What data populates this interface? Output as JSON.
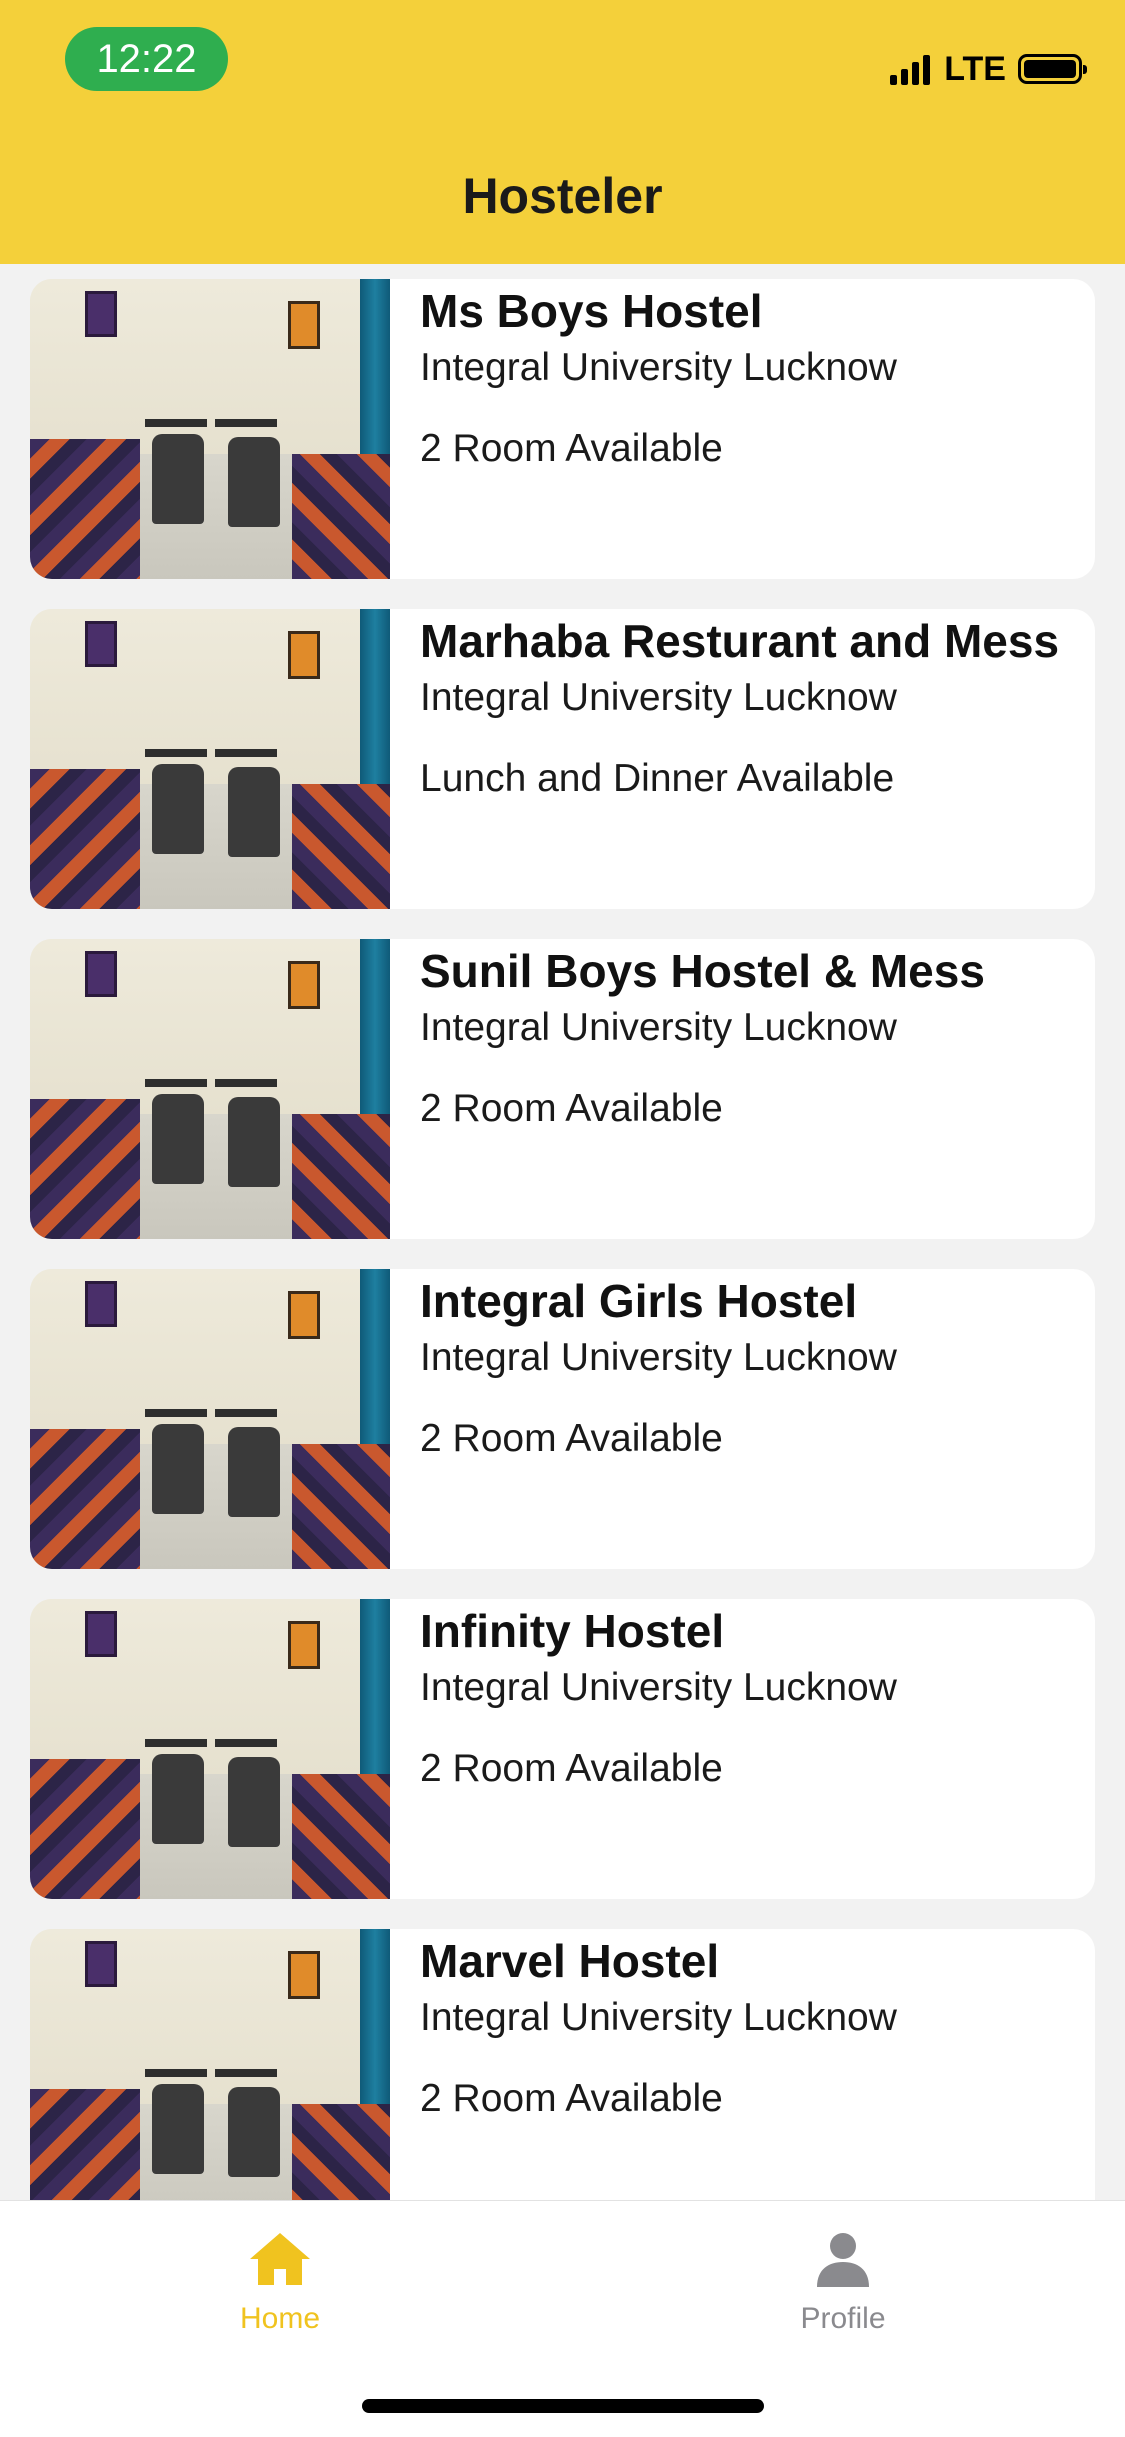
{
  "status_bar": {
    "time": "12:22",
    "network": "LTE",
    "time_pill_color": "#2fae4f"
  },
  "header": {
    "title": "Hosteler",
    "background_color": "#f4d03a"
  },
  "listings": [
    {
      "name": "Ms Boys Hostel",
      "location": "Integral University Lucknow",
      "availability": "2 Room Available"
    },
    {
      "name": "Marhaba Resturant and Mess",
      "location": "Integral University Lucknow",
      "availability": "Lunch and Dinner Available"
    },
    {
      "name": "Sunil Boys Hostel & Mess",
      "location": "Integral University Lucknow",
      "availability": "2 Room Available"
    },
    {
      "name": "Integral Girls Hostel",
      "location": "Integral University Lucknow",
      "availability": "2 Room Available"
    },
    {
      "name": "Infinity Hostel",
      "location": "Integral University Lucknow",
      "availability": "2 Room Available"
    },
    {
      "name": "Marvel Hostel",
      "location": "Integral University Lucknow",
      "availability": "2 Room Available"
    }
  ],
  "tabbar": {
    "tabs": [
      {
        "label": "Home",
        "icon": "home-icon",
        "active": true
      },
      {
        "label": "Profile",
        "icon": "person-icon",
        "active": false
      }
    ],
    "active_color": "#f0c31f",
    "inactive_color": "#8a8a8e"
  }
}
